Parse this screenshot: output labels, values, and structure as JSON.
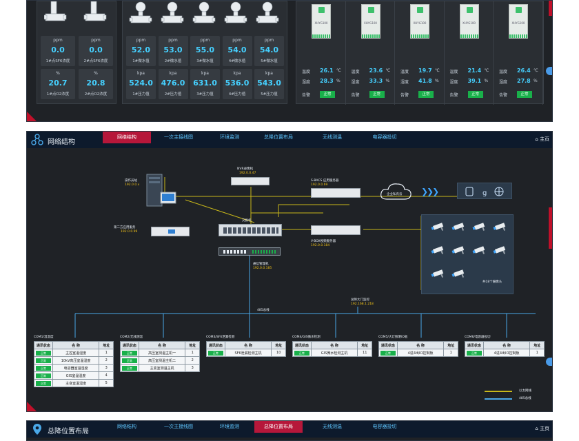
{
  "monitor": {
    "gas_cards": [
      {
        "unit": "ppm",
        "value": "0.0",
        "name": "1#点SF6浓度"
      },
      {
        "unit": "ppm",
        "value": "0.0",
        "name": "2#点SF6浓度"
      },
      {
        "unit": "%",
        "value": "20.7",
        "name": "1#点O2浓度"
      },
      {
        "unit": "%",
        "value": "20.8",
        "name": "2#点O2浓度"
      }
    ],
    "micro_cards": [
      {
        "unit": "ppm",
        "value": "52.0",
        "name": "1#微水值"
      },
      {
        "unit": "ppm",
        "value": "53.0",
        "name": "2#微水值"
      },
      {
        "unit": "ppm",
        "value": "55.0",
        "name": "3#微水值"
      },
      {
        "unit": "ppm",
        "value": "54.0",
        "name": "4#微水值"
      },
      {
        "unit": "ppm",
        "value": "54.0",
        "name": "5#微水值"
      }
    ],
    "pressure_cards": [
      {
        "unit": "kpa",
        "value": "524.0",
        "name": "1#压力值"
      },
      {
        "unit": "kpa",
        "value": "476.0",
        "name": "2#压力值"
      },
      {
        "unit": "kpa",
        "value": "631.0",
        "name": "3#压力值"
      },
      {
        "unit": "kpa",
        "value": "536.0",
        "name": "4#压力值"
      },
      {
        "unit": "kpa",
        "value": "543.0",
        "name": "5#压力值"
      }
    ],
    "th_labels": {
      "temp": "温度",
      "humi": "湿度",
      "alarm": "告警",
      "temp_unit": "℃",
      "humi_unit": "%",
      "status": "正常",
      "model": "XHYG100"
    },
    "th_devices": [
      {
        "temp": "26.1",
        "humi": "28.3"
      },
      {
        "temp": "23.6",
        "humi": "33.3"
      },
      {
        "temp": "19.7",
        "humi": "41.8"
      },
      {
        "temp": "21.4",
        "humi": "39.1"
      },
      {
        "temp": "26.4",
        "humi": "27.8"
      }
    ]
  },
  "network": {
    "title": "网络结构",
    "home": "主页",
    "tabs": [
      "网络结构",
      "一次主接线图",
      "环境监测",
      "总降位置布局",
      "无线测温",
      "电容器投切"
    ],
    "nodes": {
      "nvr": {
        "name": "NVR录像机",
        "ip": "192.0.0.47"
      },
      "ops": {
        "name": "操作员站",
        "ip": "192.0.0.x"
      },
      "sbacs": {
        "name": "S-BACS 应用服务器",
        "ip": "192.0.0.69"
      },
      "cloud": {
        "name": "企业私有云"
      },
      "switch": {
        "name": "交换机"
      },
      "server2": {
        "name": "第二方应用服务",
        "ip": "192.0.0.99"
      },
      "vbox": {
        "name": "V-BOX视频服务器",
        "ip": "192.0.0.184"
      },
      "gateway": {
        "name": "通信管理机",
        "ip": "192.0.0.185"
      },
      "bus485": {
        "name": "485总线"
      },
      "gate": {
        "name": "总降大门监控",
        "ip": "192.168.1.218"
      },
      "cameras": {
        "name": "共18个摄像头"
      }
    },
    "com_tables": [
      {
        "title": "COM1/温湿度",
        "rows": [
          {
            "status": "正常",
            "name": "主控室温湿度",
            "addr": "1"
          },
          {
            "status": "正常",
            "name": "10kV高压室温湿度",
            "addr": "2"
          },
          {
            "status": "正常",
            "name": "电容器室温湿度",
            "addr": "3"
          },
          {
            "status": "正常",
            "name": "GIS室温湿度",
            "addr": "4"
          },
          {
            "status": "正常",
            "name": "主变室温湿度",
            "addr": "5"
          }
        ]
      },
      {
        "title": "COM2/无线测温",
        "rows": [
          {
            "status": "正常",
            "name": "高压室测温主机一",
            "addr": "1"
          },
          {
            "status": "正常",
            "name": "高压室测温主机二",
            "addr": "2"
          },
          {
            "status": "正常",
            "name": "主变室测温主机",
            "addr": "3"
          }
        ]
      },
      {
        "title": "COM3/SF6泄漏检测",
        "rows": [
          {
            "status": "正常",
            "name": "SF6泄漏检测主机",
            "addr": "10"
          }
        ]
      },
      {
        "title": "COM4/GIS微水检测",
        "rows": [
          {
            "status": "正常",
            "name": "GIS微水检测主机",
            "addr": "11"
          }
        ]
      },
      {
        "title": "COM5/大灯照明IO板",
        "rows": [
          {
            "status": "正常",
            "name": "4进4出IO控制板",
            "addr": "1"
          }
        ]
      },
      {
        "title": "COM6/电容器投切",
        "rows": [
          {
            "status": "正常",
            "name": "4进4出IO控制板",
            "addr": "1"
          }
        ]
      }
    ],
    "table_headers": {
      "status": "通讯状态",
      "name": "名 称",
      "addr": "地址"
    },
    "legend": [
      {
        "label": "以太网线",
        "color": "#c9b81a"
      },
      {
        "label": "485总线",
        "color": "#4aa8e8"
      }
    ]
  },
  "bottom": {
    "title": "总降位置布局",
    "home": "主页",
    "tabs": [
      "网络结构",
      "一次主接线图",
      "环境监测",
      "总降位置布局",
      "无线测温",
      "电容器投切"
    ]
  }
}
